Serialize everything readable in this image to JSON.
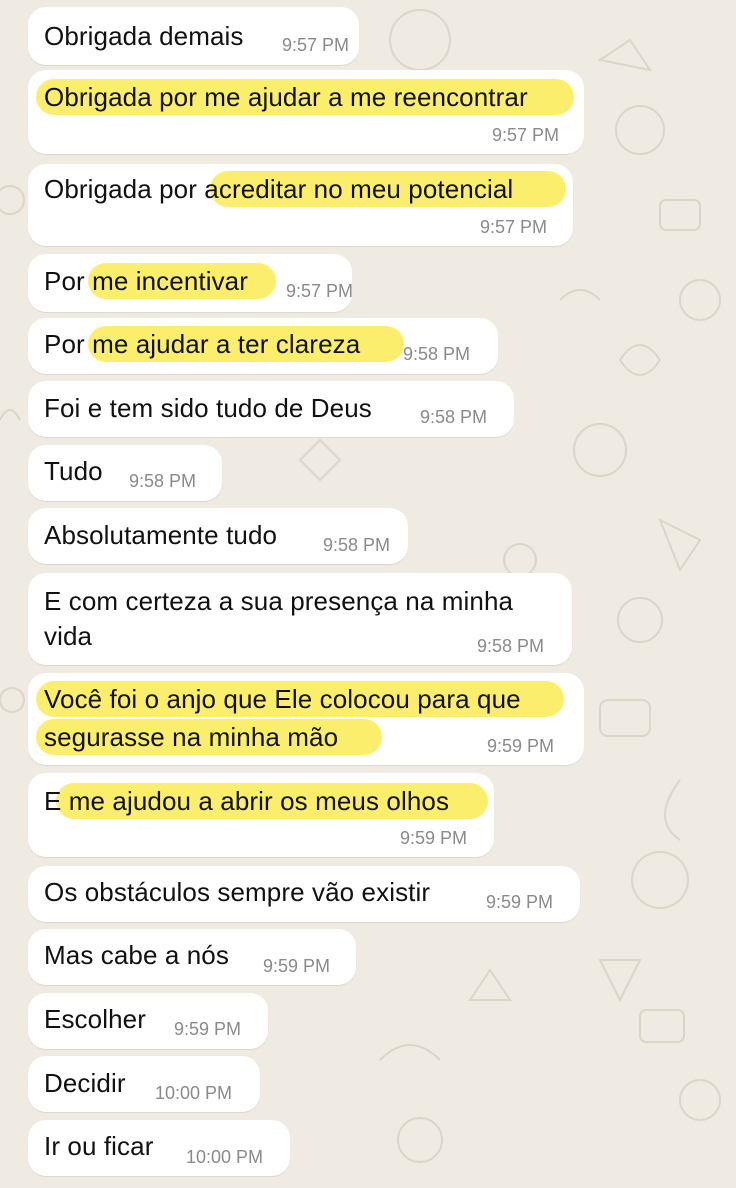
{
  "messages": [
    {
      "text": "Obrigada demais",
      "time": "9:57 PM"
    },
    {
      "text": "Obrigada por me ajudar a me reencontrar",
      "time": "9:57 PM"
    },
    {
      "text": "Obrigada por acreditar no meu potencial",
      "time": "9:57 PM"
    },
    {
      "text": "Por me incentivar",
      "time": "9:57 PM"
    },
    {
      "text": "Por me ajudar a ter clareza",
      "time": "9:58 PM"
    },
    {
      "text": "Foi e tem sido tudo de Deus",
      "time": "9:58 PM"
    },
    {
      "text": "Tudo",
      "time": "9:58 PM"
    },
    {
      "text": "Absolutamente tudo",
      "time": "9:58 PM"
    },
    {
      "line1": "E com certeza a sua presença na minha",
      "line2": "vida",
      "time": "9:58 PM"
    },
    {
      "line1": "Você foi o anjo que Ele colocou para que",
      "line2": "segurasse na minha mão",
      "time": "9:59 PM"
    },
    {
      "text": "E me ajudou a abrir os meus olhos",
      "time": "9:59 PM"
    },
    {
      "text": "Os obstáculos sempre vão existir",
      "time": "9:59 PM"
    },
    {
      "text": "Mas cabe a nós",
      "time": "9:59 PM"
    },
    {
      "text": "Escolher",
      "time": "9:59 PM"
    },
    {
      "text": "Decidir",
      "time": "10:00 PM"
    },
    {
      "text": "Ir ou ficar",
      "time": "10:00 PM"
    }
  ],
  "colors": {
    "background": "#efeae2",
    "bubble": "#ffffff",
    "highlight": "#fbee6c",
    "timestamp": "#8a8a8a"
  }
}
